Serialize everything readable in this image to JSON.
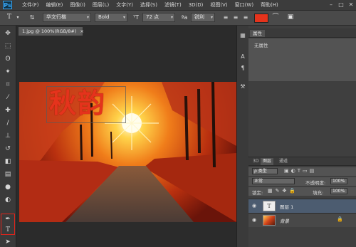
{
  "app": {
    "logo": "Ps"
  },
  "menu": {
    "items": [
      "文件(F)",
      "编辑(E)",
      "图像(I)",
      "图层(L)",
      "文字(Y)",
      "选择(S)",
      "滤镜(T)",
      "3D(D)",
      "视图(V)",
      "窗口(W)",
      "帮助(H)"
    ]
  },
  "window_controls": {
    "minimize": "–",
    "maximize": "□",
    "close": "✕"
  },
  "options": {
    "font_family": "华文行楷",
    "font_style": "Bold",
    "font_size": "72 点",
    "anti_alias": "锐利",
    "text_color": "#e5331c"
  },
  "document": {
    "tab_label": "1.jpg @ 100%(RGB/8#)",
    "canvas_text": "秋韵"
  },
  "properties": {
    "tab": "属性",
    "empty": "无属性"
  },
  "layers": {
    "tabs": [
      "3D",
      "图层",
      "通道"
    ],
    "filter_label": "ρ 类型",
    "blend_mode": "正常",
    "opacity_label": "不透明度:",
    "opacity_value": "100%",
    "lock_label": "锁定:",
    "fill_label": "填充:",
    "fill_value": "100%",
    "items": [
      {
        "name": "图层 1",
        "thumb_icon": "T"
      },
      {
        "name": "背景"
      }
    ]
  },
  "colors": {
    "accent": "#e0241b",
    "selected_layer": "#4c5c70"
  }
}
